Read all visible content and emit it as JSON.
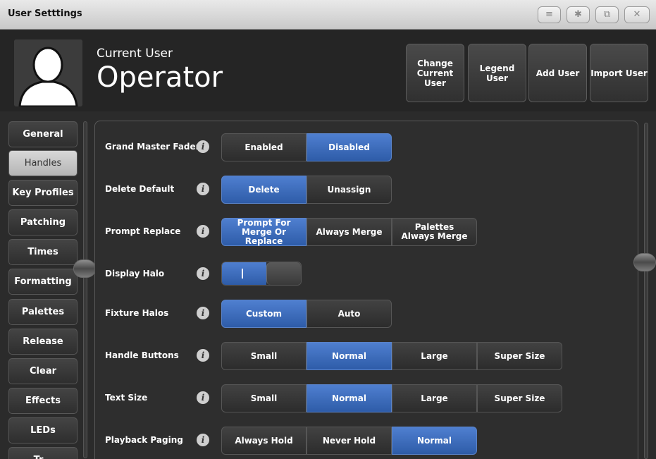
{
  "window": {
    "title": "User Setttings",
    "buttons": [
      "menu-icon",
      "gear-icon",
      "restore-icon",
      "close-icon"
    ]
  },
  "header": {
    "current_user_label": "Current User",
    "user_name": "Operator",
    "buttons": [
      {
        "label": "Change Current User"
      },
      {
        "label": "Legend User"
      },
      {
        "label": "Add User"
      },
      {
        "label": "Import User"
      }
    ]
  },
  "sidebar": {
    "items": [
      {
        "label": "General",
        "active": false
      },
      {
        "label": "Handles",
        "active": true
      },
      {
        "label": "Key Profiles",
        "active": false
      },
      {
        "label": "Patching",
        "active": false
      },
      {
        "label": "Times",
        "active": false
      },
      {
        "label": "Formatting",
        "active": false
      },
      {
        "label": "Palettes",
        "active": false
      },
      {
        "label": "Release",
        "active": false
      },
      {
        "label": "Clear",
        "active": false
      },
      {
        "label": "Effects",
        "active": false
      },
      {
        "label": "LEDs",
        "active": false
      },
      {
        "label": "Tr...",
        "active": false
      }
    ]
  },
  "settings": [
    {
      "label": "Grand Master Fader",
      "options": [
        "Enabled",
        "Disabled"
      ],
      "selected": 1
    },
    {
      "label": "Delete Default",
      "options": [
        "Delete",
        "Unassign"
      ],
      "selected": 0
    },
    {
      "label": "Prompt Replace",
      "options": [
        "Prompt For Merge Or Replace",
        "Always Merge",
        "Palettes Always Merge"
      ],
      "selected": 0
    },
    {
      "label": "Display Halo",
      "toggle": true,
      "value": "on"
    },
    {
      "label": "Fixture Halos",
      "options": [
        "Custom",
        "Auto"
      ],
      "selected": 0
    },
    {
      "label": "Handle Buttons",
      "options": [
        "Small",
        "Normal",
        "Large",
        "Super Size"
      ],
      "selected": 1
    },
    {
      "label": "Text Size",
      "options": [
        "Small",
        "Normal",
        "Large",
        "Super Size"
      ],
      "selected": 1
    },
    {
      "label": "Playback Paging",
      "options": [
        "Always Hold",
        "Never Hold",
        "Normal"
      ],
      "selected": 2
    }
  ],
  "colors": {
    "accent": "#3a68b8",
    "background": "#2b2b2b"
  }
}
